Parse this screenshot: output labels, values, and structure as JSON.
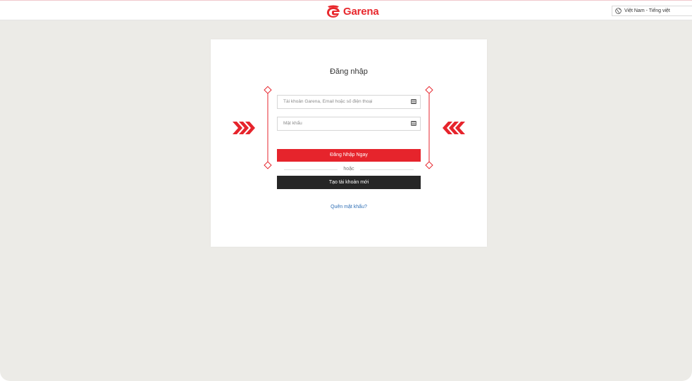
{
  "header": {
    "brand": "Garena",
    "logo_icon": "garena-logo-icon",
    "language_label": "Việt Nam - Tiếng việt",
    "language_icon": "globe-icon"
  },
  "login": {
    "title": "Đăng nhập",
    "username_placeholder": "Tài khoản Garena, Email hoặc số điện thoại",
    "password_placeholder": "Mật khẩu",
    "field_icon": "keyboard-icon",
    "login_button": "Đăng Nhập Ngay",
    "divider_text": "hoặc",
    "create_button": "Tạo tài khoản mới",
    "forgot_link": "Quên mật khẩu?"
  },
  "colors": {
    "accent": "#e6242c",
    "background": "#ecebe7",
    "dark_button": "#262626",
    "link": "#2f6fb5"
  }
}
